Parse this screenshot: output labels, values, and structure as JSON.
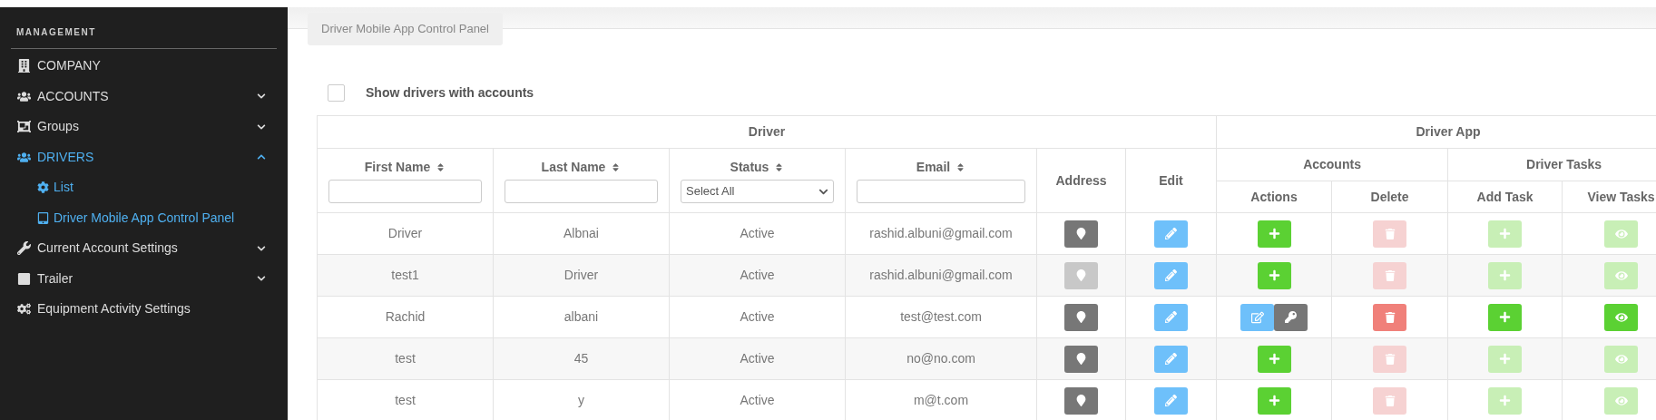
{
  "sidebar": {
    "heading": "MANAGEMENT",
    "items": [
      {
        "label": "COMPANY",
        "selected": false
      },
      {
        "label": "ACCOUNTS",
        "selected": false,
        "expanded": false
      },
      {
        "label": "Groups",
        "selected": false,
        "expanded": false
      },
      {
        "label": "DRIVERS",
        "selected": true,
        "expanded": true,
        "children": [
          {
            "label": "List"
          },
          {
            "label": "Driver Mobile App Control Panel"
          }
        ]
      },
      {
        "label": "Current Account Settings",
        "selected": false,
        "expanded": false
      },
      {
        "label": "Trailer",
        "selected": false,
        "expanded": false
      },
      {
        "label": "Equipment Activity Settings",
        "selected": false
      }
    ]
  },
  "page_tab": "Driver Mobile App Control Panel",
  "filter": {
    "label": "Show drivers with accounts",
    "checked": false
  },
  "table": {
    "groups": [
      "Driver",
      "Driver App"
    ],
    "columns": [
      {
        "label": "First Name",
        "sortable": true,
        "kind": "text"
      },
      {
        "label": "Last Name",
        "sortable": true,
        "kind": "text"
      },
      {
        "label": "Status",
        "sortable": true,
        "kind": "select",
        "value": "Select All"
      },
      {
        "label": "Email",
        "sortable": true,
        "kind": "text"
      },
      {
        "label": "Address",
        "sortable": false
      },
      {
        "label": "Edit",
        "sortable": false
      }
    ],
    "subgroups": [
      "Accounts",
      "Driver Tasks"
    ],
    "subcolumns": [
      "Actions",
      "Delete",
      "Add Task",
      "View Tasks"
    ],
    "rows": [
      {
        "first_name": "Driver",
        "last_name": "Albnai",
        "status": "Active",
        "email": "rashid.albuni@gmail.com",
        "address_enabled": true,
        "has_account": false,
        "delete_enabled": false,
        "add_task_enabled": false,
        "view_tasks_enabled": false
      },
      {
        "first_name": "test1",
        "last_name": "Driver",
        "status": "Active",
        "email": "rashid.albuni@gmail.com",
        "address_enabled": false,
        "has_account": false,
        "delete_enabled": false,
        "add_task_enabled": false,
        "view_tasks_enabled": false
      },
      {
        "first_name": "Rachid",
        "last_name": "albani",
        "status": "Active",
        "email": "test@test.com",
        "address_enabled": true,
        "has_account": true,
        "delete_enabled": true,
        "add_task_enabled": true,
        "view_tasks_enabled": true
      },
      {
        "first_name": "test",
        "last_name": "45",
        "status": "Active",
        "email": "no@no.com",
        "address_enabled": true,
        "has_account": false,
        "delete_enabled": false,
        "add_task_enabled": false,
        "view_tasks_enabled": false
      },
      {
        "first_name": "test",
        "last_name": "y",
        "status": "Active",
        "email": "m@t.com",
        "address_enabled": true,
        "has_account": false,
        "delete_enabled": false,
        "add_task_enabled": false,
        "view_tasks_enabled": false
      }
    ]
  }
}
